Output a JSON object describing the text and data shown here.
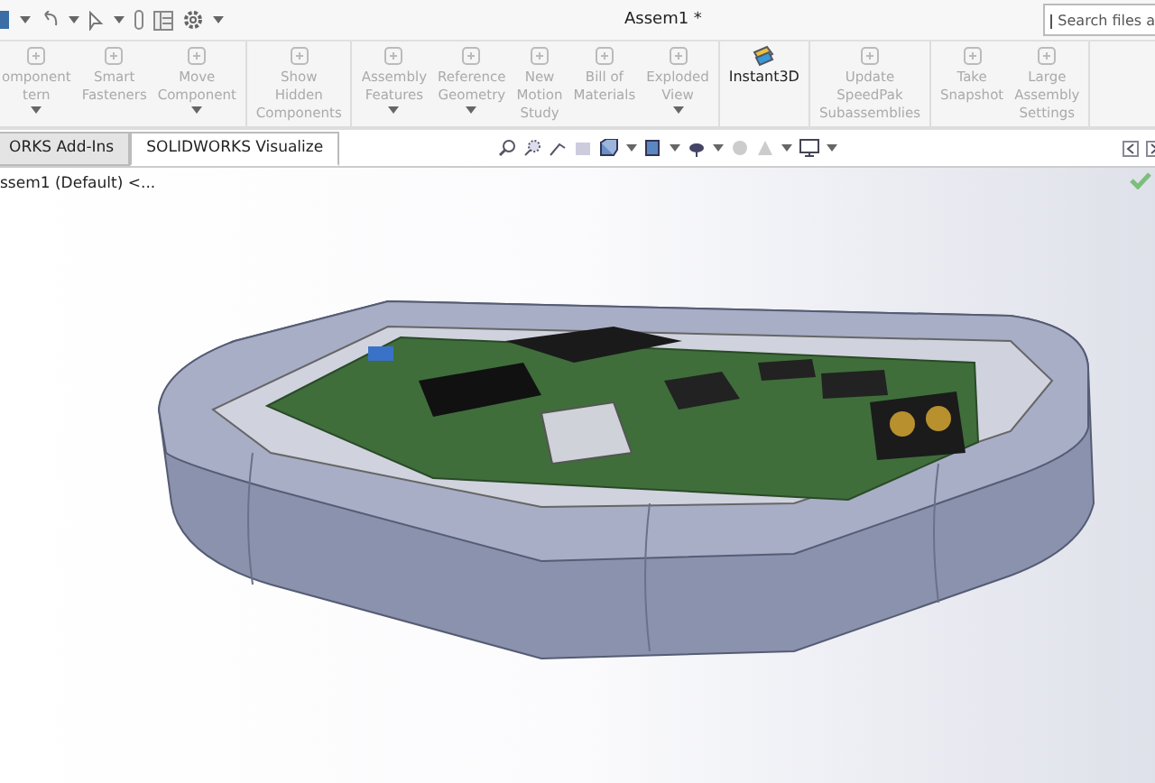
{
  "window": {
    "title": "Assem1 *"
  },
  "search": {
    "placeholder": "Search files a"
  },
  "ribbon": {
    "groups": [
      {
        "items": [
          {
            "label": "omponent\ntern",
            "disabled": true,
            "dropdown": true
          },
          {
            "label": "Smart\nFasteners",
            "disabled": true,
            "dropdown": false
          },
          {
            "label": "Move\nComponent",
            "disabled": true,
            "dropdown": true
          }
        ]
      },
      {
        "items": [
          {
            "label": "Show\nHidden\nComponents",
            "disabled": true,
            "dropdown": false
          }
        ]
      },
      {
        "items": [
          {
            "label": "Assembly\nFeatures",
            "disabled": true,
            "dropdown": true
          },
          {
            "label": "Reference\nGeometry",
            "disabled": true,
            "dropdown": true
          },
          {
            "label": "New\nMotion\nStudy",
            "disabled": true,
            "dropdown": false
          },
          {
            "label": "Bill of\nMaterials",
            "disabled": true,
            "dropdown": false
          },
          {
            "label": "Exploded\nView",
            "disabled": true,
            "dropdown": true
          }
        ]
      },
      {
        "items": [
          {
            "label": "Instant3D",
            "disabled": false,
            "dropdown": false
          }
        ]
      },
      {
        "items": [
          {
            "label": "Update\nSpeedPak\nSubassemblies",
            "disabled": true,
            "dropdown": false
          }
        ]
      },
      {
        "items": [
          {
            "label": "Take\nSnapshot",
            "disabled": true,
            "dropdown": false
          },
          {
            "label": "Large\nAssembly\nSettings",
            "disabled": true,
            "dropdown": false
          }
        ]
      }
    ]
  },
  "tabs": [
    {
      "label": "ORKS Add-Ins",
      "selected": false
    },
    {
      "label": "SOLIDWORKS Visualize",
      "selected": true
    }
  ],
  "tree": {
    "root": "ssem1 (Default) <..."
  }
}
